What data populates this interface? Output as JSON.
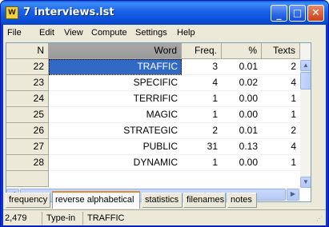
{
  "window": {
    "title": "7 interviews.lst",
    "app_icon_text": "W"
  },
  "menu": {
    "items": [
      {
        "label": "File"
      },
      {
        "label": "Edit"
      },
      {
        "label": "View"
      },
      {
        "label": "Compute"
      },
      {
        "label": "Settings"
      },
      {
        "label": "Help"
      }
    ]
  },
  "table": {
    "headers": {
      "n": "N",
      "word": "Word",
      "freq": "Freq.",
      "pct": "%",
      "texts": "Texts"
    },
    "rows": [
      {
        "n": "22",
        "word": "TRAFFIC",
        "freq": "3",
        "pct": "0.01",
        "texts": "2"
      },
      {
        "n": "23",
        "word": "SPECIFIC",
        "freq": "4",
        "pct": "0.02",
        "texts": "4"
      },
      {
        "n": "24",
        "word": "TERRIFIC",
        "freq": "1",
        "pct": "0.00",
        "texts": "1"
      },
      {
        "n": "25",
        "word": "MAGIC",
        "freq": "1",
        "pct": "0.00",
        "texts": "1"
      },
      {
        "n": "26",
        "word": "STRATEGIC",
        "freq": "2",
        "pct": "0.01",
        "texts": "2"
      },
      {
        "n": "27",
        "word": "PUBLIC",
        "freq": "31",
        "pct": "0.13",
        "texts": "4"
      },
      {
        "n": "28",
        "word": "DYNAMIC",
        "freq": "1",
        "pct": "0.00",
        "texts": "1"
      }
    ],
    "selected_row": 0
  },
  "tabs": [
    {
      "label": "frequency"
    },
    {
      "label": "reverse alphabetical",
      "active": true
    },
    {
      "label": "statistics"
    },
    {
      "label": "filenames"
    },
    {
      "label": "notes"
    }
  ],
  "status": {
    "count": "2,479",
    "mode": "Type-in",
    "current": "TRAFFIC"
  },
  "colors": {
    "titlebar": "#0b4fd8",
    "selection": "#316ac5",
    "active_tab_accent": "#e68b2c"
  }
}
